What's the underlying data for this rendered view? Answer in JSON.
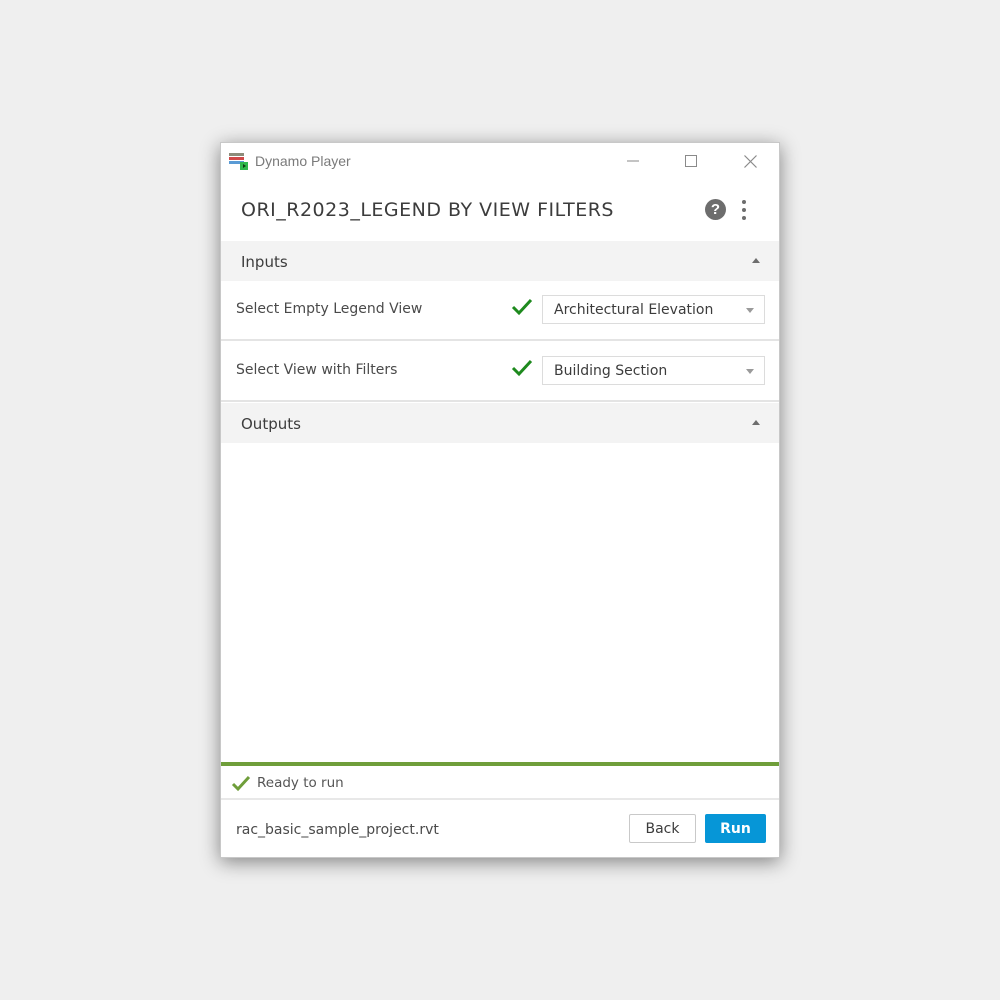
{
  "window": {
    "app_title": "Dynamo Player",
    "app_icon": "dynamo-player-icon",
    "controls": {
      "minimize": "minimize-icon",
      "maximize": "maximize-icon",
      "close": "close-icon"
    }
  },
  "header": {
    "title": "ORI_R2023_LEGEND BY VIEW FILTERS",
    "help_icon": "help-icon",
    "help_glyph": "?",
    "more_icon": "more-vertical-icon"
  },
  "inputs": {
    "section_label": "Inputs",
    "rows": [
      {
        "label": "Select Empty Legend View",
        "status": "valid",
        "value": "Architectural Elevation"
      },
      {
        "label": "Select View with Filters",
        "status": "valid",
        "value": "Building Section"
      }
    ]
  },
  "outputs": {
    "section_label": "Outputs"
  },
  "progress": {
    "value_percent": 100,
    "color": "#6f9e3a"
  },
  "status": {
    "text": "Ready to run",
    "icon": "check-icon",
    "color": "#6f9e3a"
  },
  "footer": {
    "filename": "rac_basic_sample_project.rvt",
    "back_label": "Back",
    "run_label": "Run",
    "run_color": "#0696d7"
  },
  "colors": {
    "check_green": "#1e8a1e"
  }
}
